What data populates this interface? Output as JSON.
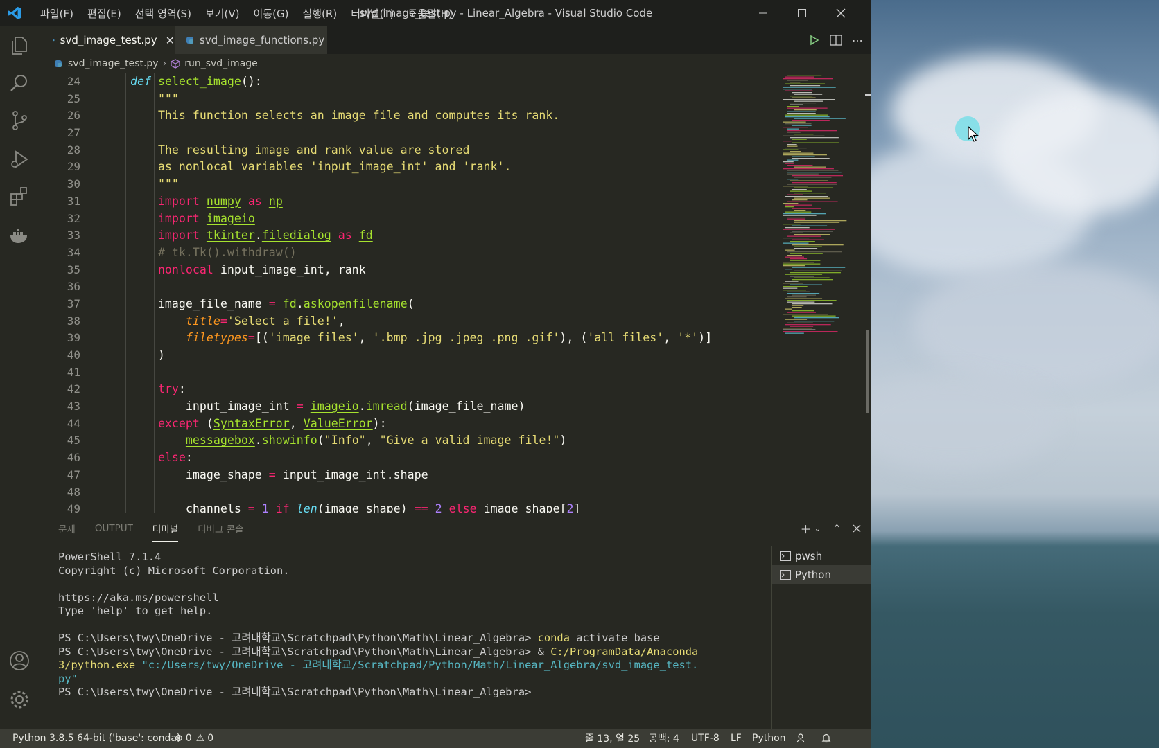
{
  "window": {
    "title": "svd_image_test.py - Linear_Algebra - Visual Studio Code",
    "menu": [
      "파일(F)",
      "편집(E)",
      "선택 영역(S)",
      "보기(V)",
      "이동(G)",
      "실행(R)",
      "터미널(T)",
      "도움말(H)"
    ]
  },
  "tabs": [
    {
      "label": "svd_image_test.py",
      "active": true
    },
    {
      "label": "svd_image_functions.py",
      "active": false
    }
  ],
  "breadcrumb": {
    "file": "svd_image_test.py",
    "symbol": "run_svd_image"
  },
  "editor": {
    "line_numbers": [
      "24",
      "25",
      "26",
      "27",
      "28",
      "29",
      "30",
      "31",
      "32",
      "33",
      "34",
      "35",
      "36",
      "37",
      "38",
      "39",
      "40",
      "41",
      "42",
      "43",
      "44",
      "45",
      "46",
      "47",
      "48",
      "49"
    ],
    "lines": [
      [
        {
          "t": "    "
        },
        {
          "t": "def",
          "c": "kwi"
        },
        {
          "t": " "
        },
        {
          "t": "select_image",
          "c": "fn"
        },
        {
          "t": "():"
        }
      ],
      [
        {
          "t": "        "
        },
        {
          "t": "\"\"\"",
          "c": "str"
        }
      ],
      [
        {
          "t": "        "
        },
        {
          "t": "This function selects an image file and computes its rank.",
          "c": "str"
        }
      ],
      [
        {
          "t": ""
        }
      ],
      [
        {
          "t": "        "
        },
        {
          "t": "The resulting image and rank value are stored",
          "c": "str"
        }
      ],
      [
        {
          "t": "        "
        },
        {
          "t": "as nonlocal variables 'input_image_int' and 'rank'.",
          "c": "str"
        }
      ],
      [
        {
          "t": "        "
        },
        {
          "t": "\"\"\"",
          "c": "str"
        }
      ],
      [
        {
          "t": "        "
        },
        {
          "t": "import",
          "c": "kw"
        },
        {
          "t": " "
        },
        {
          "t": "numpy",
          "c": "ul"
        },
        {
          "t": " "
        },
        {
          "t": "as",
          "c": "kw"
        },
        {
          "t": " "
        },
        {
          "t": "np",
          "c": "ul"
        }
      ],
      [
        {
          "t": "        "
        },
        {
          "t": "import",
          "c": "kw"
        },
        {
          "t": " "
        },
        {
          "t": "imageio",
          "c": "ul"
        }
      ],
      [
        {
          "t": "        "
        },
        {
          "t": "import",
          "c": "kw"
        },
        {
          "t": " "
        },
        {
          "t": "tkinter",
          "c": "ul"
        },
        {
          "t": "."
        },
        {
          "t": "filedialog",
          "c": "ul"
        },
        {
          "t": " "
        },
        {
          "t": "as",
          "c": "kw"
        },
        {
          "t": " "
        },
        {
          "t": "fd",
          "c": "ul"
        }
      ],
      [
        {
          "t": "        "
        },
        {
          "t": "# tk.Tk().withdraw()",
          "c": "cm"
        }
      ],
      [
        {
          "t": "        "
        },
        {
          "t": "nonlocal",
          "c": "kw"
        },
        {
          "t": " input_image_int, rank"
        }
      ],
      [
        {
          "t": ""
        }
      ],
      [
        {
          "t": "        image_file_name "
        },
        {
          "t": "=",
          "c": "kw"
        },
        {
          "t": " "
        },
        {
          "t": "fd",
          "c": "ul"
        },
        {
          "t": "."
        },
        {
          "t": "askopenfilename",
          "c": "fn"
        },
        {
          "t": "("
        }
      ],
      [
        {
          "t": "            "
        },
        {
          "t": "title",
          "c": "par"
        },
        {
          "t": "=",
          "c": "kw"
        },
        {
          "t": "'Select a file!'",
          "c": "str"
        },
        {
          "t": ","
        }
      ],
      [
        {
          "t": "            "
        },
        {
          "t": "filetypes",
          "c": "par"
        },
        {
          "t": "=",
          "c": "kw"
        },
        {
          "t": "[("
        },
        {
          "t": "'image files'",
          "c": "str"
        },
        {
          "t": ", "
        },
        {
          "t": "'.bmp .jpg .jpeg .png .gif'",
          "c": "str"
        },
        {
          "t": "), ("
        },
        {
          "t": "'all files'",
          "c": "str"
        },
        {
          "t": ", "
        },
        {
          "t": "'*'",
          "c": "str"
        },
        {
          "t": ")]"
        }
      ],
      [
        {
          "t": "        )"
        }
      ],
      [
        {
          "t": ""
        }
      ],
      [
        {
          "t": "        "
        },
        {
          "t": "try",
          "c": "kw"
        },
        {
          "t": ":"
        }
      ],
      [
        {
          "t": "            input_image_int "
        },
        {
          "t": "=",
          "c": "kw"
        },
        {
          "t": " "
        },
        {
          "t": "imageio",
          "c": "ul"
        },
        {
          "t": "."
        },
        {
          "t": "imread",
          "c": "fn"
        },
        {
          "t": "(image_file_name)"
        }
      ],
      [
        {
          "t": "        "
        },
        {
          "t": "except",
          "c": "kw"
        },
        {
          "t": " ("
        },
        {
          "t": "SyntaxError",
          "c": "ul"
        },
        {
          "t": ", "
        },
        {
          "t": "ValueError",
          "c": "ul"
        },
        {
          "t": "):"
        }
      ],
      [
        {
          "t": "            "
        },
        {
          "t": "messagebox",
          "c": "ul"
        },
        {
          "t": "."
        },
        {
          "t": "showinfo",
          "c": "fn"
        },
        {
          "t": "("
        },
        {
          "t": "\"Info\"",
          "c": "str"
        },
        {
          "t": ", "
        },
        {
          "t": "\"Give a valid image file!\"",
          "c": "str"
        },
        {
          "t": ")"
        }
      ],
      [
        {
          "t": "        "
        },
        {
          "t": "else",
          "c": "kw"
        },
        {
          "t": ":"
        }
      ],
      [
        {
          "t": "            image_shape "
        },
        {
          "t": "=",
          "c": "kw"
        },
        {
          "t": " input_image_int.shape"
        }
      ],
      [
        {
          "t": ""
        }
      ],
      [
        {
          "t": "            channels "
        },
        {
          "t": "=",
          "c": "kw"
        },
        {
          "t": " "
        },
        {
          "t": "1",
          "c": "num"
        },
        {
          "t": " "
        },
        {
          "t": "if",
          "c": "kw"
        },
        {
          "t": " "
        },
        {
          "t": "len",
          "c": "kwi"
        },
        {
          "t": "(image_shape) "
        },
        {
          "t": "==",
          "c": "kw"
        },
        {
          "t": " "
        },
        {
          "t": "2",
          "c": "num"
        },
        {
          "t": " "
        },
        {
          "t": "else",
          "c": "kw"
        },
        {
          "t": " image_shape["
        },
        {
          "t": "2",
          "c": "num"
        },
        {
          "t": "]"
        }
      ]
    ]
  },
  "panel": {
    "tabs": [
      "문제",
      "OUTPUT",
      "터미널",
      "디버그 콘솔"
    ],
    "active_tab": "터미널",
    "terminal_lines": [
      [
        {
          "t": "PowerShell 7.1.4"
        }
      ],
      [
        {
          "t": "Copyright (c) Microsoft Corporation."
        }
      ],
      [
        {
          "t": ""
        }
      ],
      [
        {
          "t": "https://aka.ms/powershell"
        }
      ],
      [
        {
          "t": "Type 'help' to get help."
        }
      ],
      [
        {
          "t": ""
        }
      ],
      [
        {
          "t": "PS C:\\Users\\twy\\OneDrive - 고려대학교\\Scratchpad\\Python\\Math\\Linear_Algebra> "
        },
        {
          "t": "conda",
          "c": "t-yellow"
        },
        {
          "t": " activate base"
        }
      ],
      [
        {
          "t": "PS C:\\Users\\twy\\OneDrive - 고려대학교\\Scratchpad\\Python\\Math\\Linear_Algebra> & "
        },
        {
          "t": "C:/ProgramData/Anaconda",
          "c": "t-yellow"
        }
      ],
      [
        {
          "t": "3/python.exe",
          "c": "t-yellow"
        },
        {
          "t": " "
        },
        {
          "t": "\"c:/Users/twy/OneDrive - 고려대학교/Scratchpad/Python/Math/Linear_Algebra/svd_image_test.",
          "c": "t-cyan"
        }
      ],
      [
        {
          "t": "py\"",
          "c": "t-cyan"
        }
      ],
      [
        {
          "t": "PS C:\\Users\\twy\\OneDrive - 고려대학교\\Scratchpad\\Python\\Math\\Linear_Algebra>"
        }
      ]
    ],
    "terminals": [
      "pwsh",
      "Python"
    ],
    "selected_terminal": "Python"
  },
  "statusbar": {
    "interpreter": "Python 3.8.5 64-bit ('base': conda)",
    "errors": "0",
    "warnings": "0",
    "position": "줄 13, 열 25",
    "spaces": "공백: 4",
    "encoding": "UTF-8",
    "eol": "LF",
    "language": "Python"
  },
  "colors": {
    "editor_bg": "#272822",
    "keyword": "#f92672",
    "string": "#e6db74",
    "function": "#a6e22e",
    "comment": "#75715e",
    "number": "#ae81ff"
  }
}
